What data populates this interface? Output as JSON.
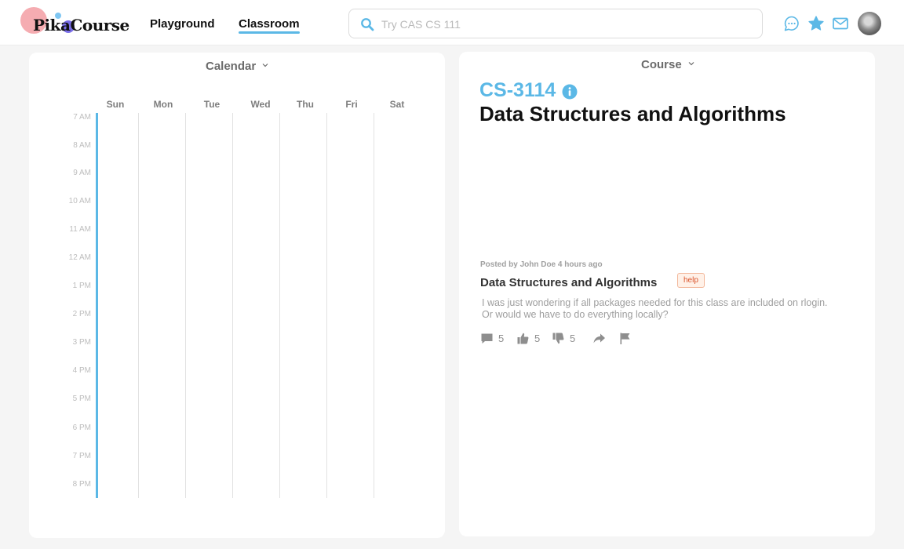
{
  "header": {
    "logo_text": "PikaCourse",
    "nav": {
      "playground": "Playground",
      "classroom": "Classroom"
    },
    "search": {
      "placeholder": "Try CAS CS 111",
      "value": ""
    },
    "icons": [
      "chat-icon",
      "star-icon",
      "mail-icon",
      "avatar"
    ]
  },
  "calendar": {
    "title": "Calendar",
    "days": [
      "Sun",
      "Mon",
      "Tue",
      "Wed",
      "Thu",
      "Fri",
      "Sat"
    ],
    "times": [
      "7 AM",
      "8 AM",
      "9 AM",
      "10 AM",
      "11 AM",
      "12 AM",
      "1 PM",
      "2 PM",
      "3 PM",
      "4 PM",
      "5 PM",
      "6 PM",
      "7 PM",
      "8 PM"
    ]
  },
  "course": {
    "title": "Course",
    "code": "CS-3114",
    "name": "Data Structures and Algorithms",
    "post": {
      "meta": "Posted by John Doe 4 hours ago",
      "title": "Data Structures and Algorithms",
      "tag": "help",
      "body": "I was just wondering if all packages needed for this class are included on rlogin. Or would we have to do everything locally?",
      "comments": "5",
      "likes": "5",
      "dislikes": "5"
    }
  },
  "colors": {
    "accent": "#5bb8e6",
    "tag_text": "#d9532b",
    "tag_bg": "#fff1e8",
    "muted_text": "#9e9e9e"
  }
}
